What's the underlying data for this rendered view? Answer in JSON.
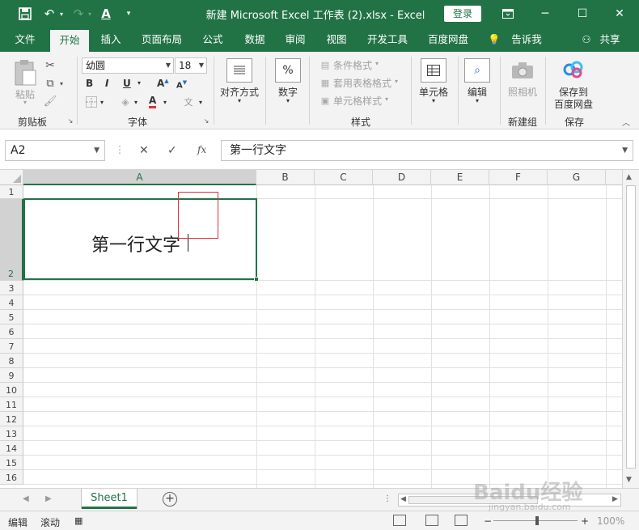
{
  "titlebar": {
    "title": "新建 Microsoft Excel 工作表 (2).xlsx  -  Excel",
    "login": "登录"
  },
  "tabs": [
    "文件",
    "开始",
    "插入",
    "页面布局",
    "公式",
    "数据",
    "审阅",
    "视图",
    "开发工具",
    "百度网盘",
    "告诉我",
    "共享"
  ],
  "ribbon": {
    "clipboard": {
      "label": "剪贴板",
      "paste": "粘贴"
    },
    "font": {
      "label": "字体",
      "font_name": "幼圆",
      "font_size": "18",
      "bold": "B",
      "italic": "I",
      "underline": "U"
    },
    "alignment": {
      "label": "对齐方式"
    },
    "number": {
      "label": "数字"
    },
    "styles": {
      "label": "样式",
      "conditional": "条件格式",
      "table": "套用表格格式",
      "cell_style": "单元格样式"
    },
    "cells": {
      "label": "单元格"
    },
    "editing": {
      "label": "编辑"
    },
    "camera": {
      "label": "照相机"
    },
    "newgroup": {
      "label": "新建组"
    },
    "save": {
      "label": "保存",
      "button": "保存到",
      "button2": "百度网盘"
    }
  },
  "formula_bar": {
    "name_box": "A2",
    "formula": "第一行文字"
  },
  "columns": [
    "A",
    "B",
    "C",
    "D",
    "E",
    "F",
    "G"
  ],
  "rows": [
    "1",
    "2",
    "3",
    "4",
    "5",
    "6",
    "7",
    "8",
    "9",
    "10",
    "11",
    "12",
    "13",
    "14",
    "15",
    "16"
  ],
  "active_cell": {
    "text": "第一行文字"
  },
  "sheets": [
    "Sheet1"
  ],
  "statusbar": {
    "mode": "编辑",
    "scroll": "滚动",
    "zoom": "100%"
  },
  "watermark": {
    "text": "Baidu经验",
    "url": "jingyan.baidu.com"
  },
  "colors": {
    "accent": "#217346",
    "highlight": "#e0303c"
  }
}
